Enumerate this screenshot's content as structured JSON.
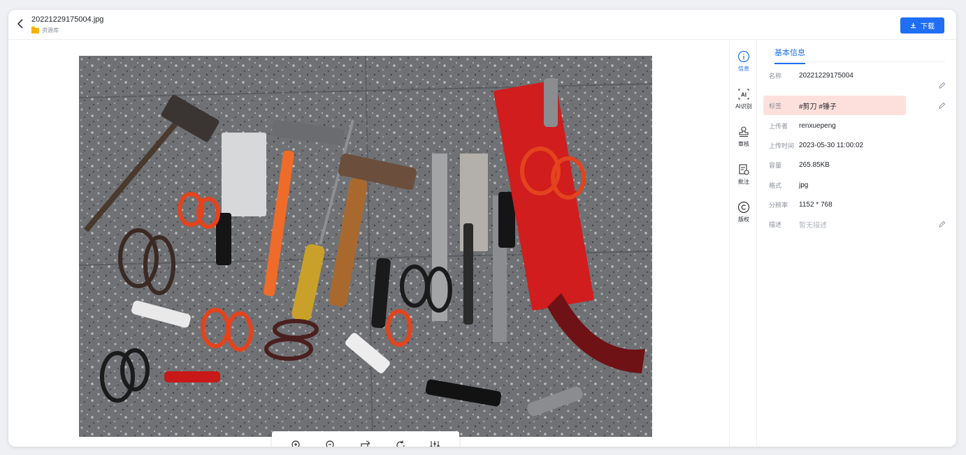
{
  "header": {
    "back_icon": "chevron-left-icon",
    "file_name": "20221229175004.jpg",
    "breadcrumb": "资源库",
    "download_label": "下载"
  },
  "toolbar": {
    "tools": [
      "zoom-in-icon",
      "zoom-out-icon",
      "rotate-icon",
      "refresh-icon",
      "adjust-icon"
    ]
  },
  "side_tabs": [
    {
      "label": "信息",
      "icon": "info-icon",
      "active": true
    },
    {
      "label": "AI识别",
      "icon": "ai-icon",
      "active": false
    },
    {
      "label": "审核",
      "icon": "stamp-icon",
      "active": false
    },
    {
      "label": "批注",
      "icon": "annotate-icon",
      "active": false
    },
    {
      "label": "版权",
      "icon": "copyright-icon",
      "active": false
    }
  ],
  "panel": {
    "tab_label": "基本信息",
    "fields": [
      {
        "key": "名称",
        "value": "20221229175004",
        "editable": true
      },
      {
        "key": "标签",
        "value": "#剪刀 #锤子",
        "editable": true,
        "highlight": true
      },
      {
        "key": "上传者",
        "value": "renxuepeng",
        "editable": false
      },
      {
        "key": "上传时间",
        "value": "2023-05-30 11:00:02",
        "editable": false
      },
      {
        "key": "容量",
        "value": "265.85KB",
        "editable": false
      },
      {
        "key": "格式",
        "value": "jpg",
        "editable": false
      },
      {
        "key": "分辨率",
        "value": "1152 * 768",
        "editable": false
      },
      {
        "key": "描述",
        "value": "暂无描述",
        "editable": true,
        "muted": true
      }
    ]
  },
  "colors": {
    "accent": "#1f6ef5",
    "tag_highlight": "#fde0dc"
  }
}
